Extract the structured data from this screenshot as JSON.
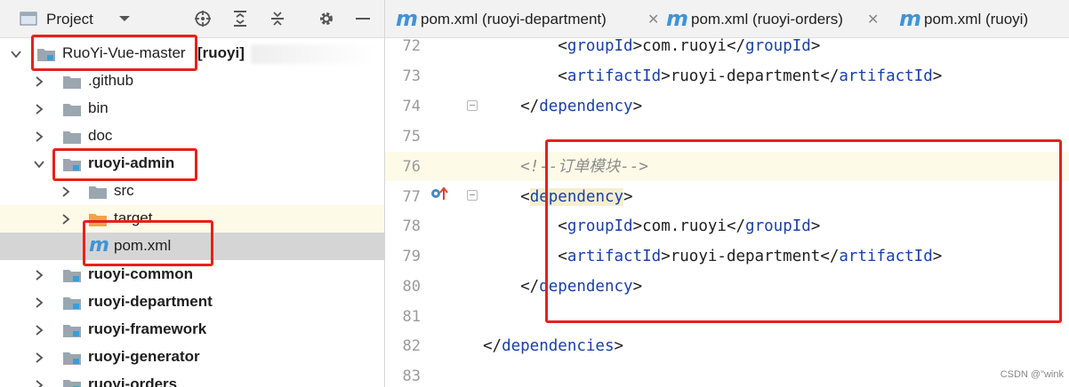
{
  "project_panel": {
    "title": "Project",
    "items": [
      {
        "label": "RuoYi-Vue-master",
        "suffix": "[ruoyi]",
        "expanded": true,
        "bold": false
      },
      {
        "label": ".github"
      },
      {
        "label": "bin"
      },
      {
        "label": "doc"
      },
      {
        "label": "ruoyi-admin",
        "expanded": true,
        "bold": true
      },
      {
        "label": "src"
      },
      {
        "label": "target"
      },
      {
        "label": "pom.xml"
      },
      {
        "label": "ruoyi-common",
        "bold": true
      },
      {
        "label": "ruoyi-department",
        "bold": true
      },
      {
        "label": "ruoyi-framework",
        "bold": true
      },
      {
        "label": "ruoyi-generator",
        "bold": true
      },
      {
        "label": "ruoyi-orders",
        "bold": true
      }
    ]
  },
  "tabs": [
    {
      "icon": "m",
      "label": "pom.xml (ruoyi-department)"
    },
    {
      "icon": "m",
      "label": "pom.xml (ruoyi-orders)"
    },
    {
      "icon": "m",
      "label": "pom.xml (ruoyi)"
    }
  ],
  "editor": {
    "lines": [
      {
        "num": "72",
        "open": "<",
        "tag": "groupId",
        "text": "com.ruoyi",
        "close": "</",
        "tag2": "groupId"
      },
      {
        "num": "73",
        "open": "<",
        "tag": "artifactId",
        "text": "ruoyi-department",
        "close": "</",
        "tag2": "artifactId"
      },
      {
        "num": "74",
        "tag": "dependency"
      },
      {
        "num": "75"
      },
      {
        "num": "76",
        "comment": "<!--订单模块-->"
      },
      {
        "num": "77",
        "tag": "dependency"
      },
      {
        "num": "78",
        "tag": "groupId",
        "text": "com.ruoyi"
      },
      {
        "num": "79",
        "tag": "artifactId",
        "text": "ruoyi-department"
      },
      {
        "num": "80",
        "tag": "dependency"
      },
      {
        "num": "81"
      },
      {
        "num": "82",
        "tag": "dependencies"
      },
      {
        "num": "83"
      }
    ]
  },
  "watermark": "CSDN @\"wink"
}
